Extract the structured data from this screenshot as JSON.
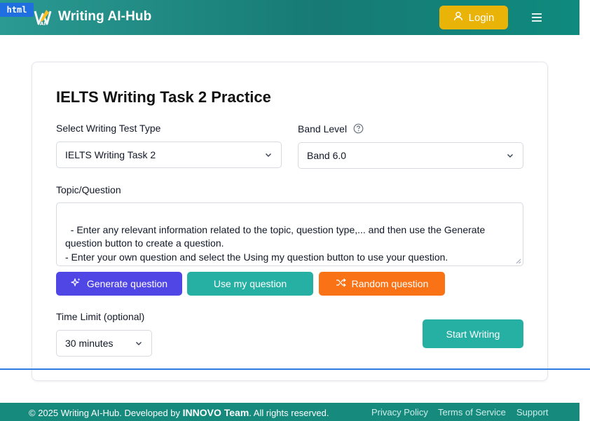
{
  "header": {
    "badge": "html",
    "brand": "Writing AI-Hub",
    "login_label": "Login"
  },
  "page": {
    "title": "IELTS Writing Task 2 Practice",
    "test_type_label": "Select Writing Test Type",
    "test_type_value": "IELTS Writing Task 2",
    "band_label": "Band Level",
    "band_value": "Band 6.0",
    "topic_label": "Topic/Question",
    "topic_placeholder": "- Enter any relevant information related to the topic, question type,... and then use the Generate question button to create a question.\n- Enter your own question and select the Using my question button to use your question.",
    "generate_label": "Generate question",
    "use_label": "Use my question",
    "random_label": "Random question",
    "time_label": "Time Limit (optional)",
    "time_value": "30 minutes",
    "start_label": "Start Writing"
  },
  "footer": {
    "copy_prefix": "© 2025 Writing AI-Hub. Developed by ",
    "team": "INNOVO Team",
    "copy_suffix": ". All rights reserved.",
    "links": [
      "Privacy Policy",
      "Terms of Service",
      "Support"
    ]
  },
  "colors": {
    "header_teal": "#177a74",
    "login_yellow": "#eab308",
    "generate_indigo": "#4f46e5",
    "use_teal": "#26b0a4",
    "random_orange": "#f97316",
    "footer_teal": "#178a7e"
  },
  "icons": {
    "logo": "writing-ai-hub-logo",
    "login": "user-icon",
    "menu": "hamburger-menu-icon",
    "help": "question-circle-icon",
    "dropdown": "chevron-down-icon",
    "generate": "sparkles-icon",
    "random": "shuffle-icon"
  }
}
